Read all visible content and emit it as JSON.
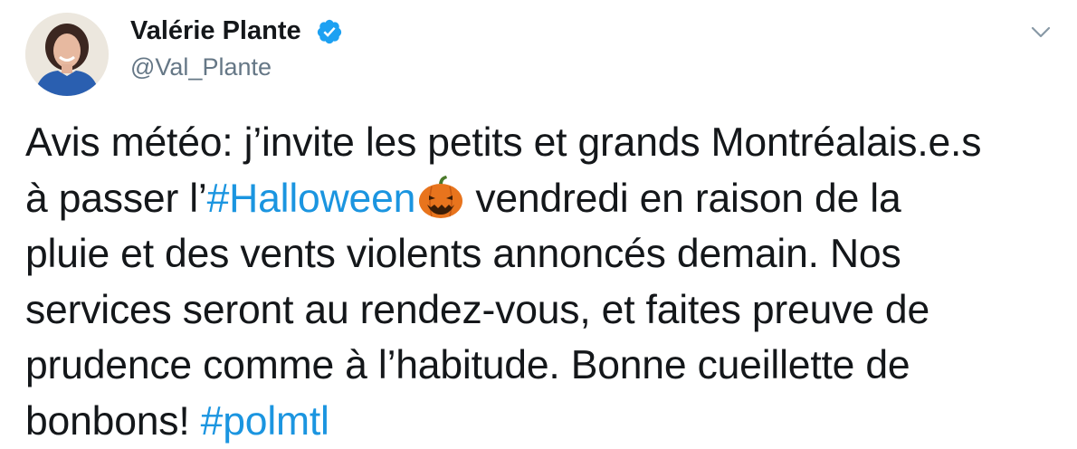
{
  "author": {
    "display_name": "Valérie Plante",
    "handle": "@Val_Plante",
    "verified": true
  },
  "icons": {
    "verified": "verified-badge-icon",
    "menu": "chevron-down-icon",
    "emoji": "jack-o-lantern-emoji"
  },
  "colors": {
    "text": "#14171a",
    "secondary": "#657786",
    "link": "#1b95e0",
    "verified": "#1da1f2",
    "pumpkin": "#e8741d"
  },
  "tweet": {
    "line1": "Avis météo: j’invite les petits et grands Montréalais.e.s",
    "line2_prefix": "à passer l’",
    "hashtag1": "#Halloween",
    "line2_suffix": " vendredi en raison de la",
    "line3": "pluie et des vents violents annoncés demain. Nos",
    "line4": "services seront au rendez-vous, et faites preuve de",
    "line5": "prudence comme à l’habitude. Bonne cueillette de",
    "line6_prefix": "bonbons! ",
    "hashtag2": "#polmtl"
  }
}
